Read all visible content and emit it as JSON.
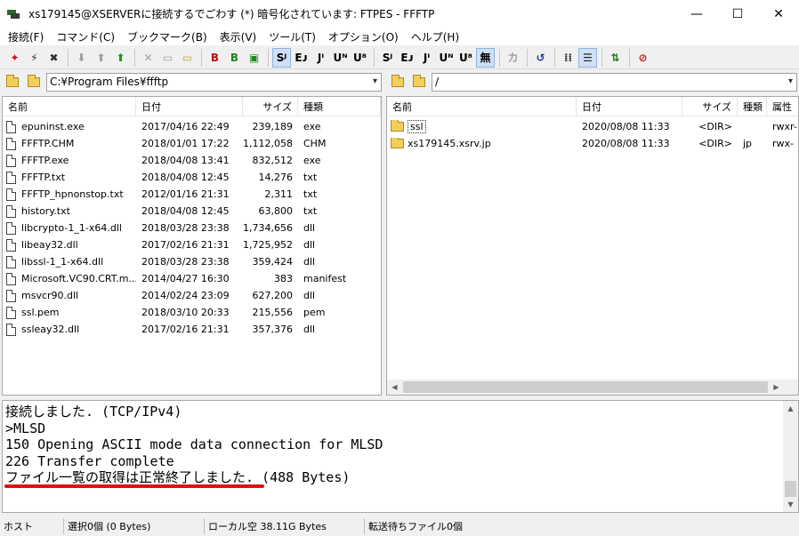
{
  "window": {
    "title": "xs179145@XSERVERに接続するでごわす (*) 暗号化されています: FTPES - FFFTP",
    "minimize": "—",
    "maximize": "☐",
    "close": "✕"
  },
  "menu": [
    "接続(F)",
    "コマンド(C)",
    "ブックマーク(B)",
    "表示(V)",
    "ツール(T)",
    "オプション(O)",
    "ヘルプ(H)"
  ],
  "toolbar": {
    "buttons": [
      {
        "name": "connect-icon",
        "glyph": "✦",
        "color": "#d01010"
      },
      {
        "name": "quick-connect-icon",
        "glyph": "⚡",
        "color": "#303030"
      },
      {
        "name": "disconnect-icon",
        "glyph": "✖",
        "color": "#303030"
      },
      {
        "name": "download-icon",
        "glyph": "⬇",
        "color": "#a0a0a0"
      },
      {
        "name": "upload-icon",
        "glyph": "⬆",
        "color": "#a0a0a0"
      },
      {
        "name": "mirror-upload-icon",
        "glyph": "⬆",
        "color": "#1a9a1a"
      },
      {
        "name": "delete-icon",
        "glyph": "✕",
        "color": "#a0a0a0"
      },
      {
        "name": "rename-icon",
        "glyph": "▭",
        "color": "#a0a0a0"
      },
      {
        "name": "mkdir-icon",
        "glyph": "▭",
        "color": "#c8a030"
      },
      {
        "name": "text-mode-icon",
        "glyph": "B",
        "color": "#c01010"
      },
      {
        "name": "binary-mode-icon",
        "glyph": "B",
        "color": "#1a8a1a"
      },
      {
        "name": "auto-mode-icon",
        "glyph": "▣",
        "color": "#1a8a1a"
      },
      {
        "name": "host-sjis-icon",
        "glyph": "Sᴶ",
        "color": "#000000"
      },
      {
        "name": "host-euc-icon",
        "glyph": "Eᴊ",
        "color": "#000000"
      },
      {
        "name": "host-jis-icon",
        "glyph": "Jᴵ",
        "color": "#000000"
      },
      {
        "name": "host-utf8n-icon",
        "glyph": "Uᴺ",
        "color": "#000000"
      },
      {
        "name": "host-utf8-icon",
        "glyph": "U⁸",
        "color": "#000000"
      },
      {
        "name": "local-sjis-icon",
        "glyph": "Sᴶ",
        "color": "#000000"
      },
      {
        "name": "local-euc-icon",
        "glyph": "Eᴊ",
        "color": "#000000"
      },
      {
        "name": "local-jis-icon",
        "glyph": "Jᴵ",
        "color": "#000000"
      },
      {
        "name": "local-utf8n-icon",
        "glyph": "Uᴺ",
        "color": "#000000"
      },
      {
        "name": "local-utf8-icon",
        "glyph": "U⁸",
        "color": "#000000"
      },
      {
        "name": "no-convert-icon",
        "glyph": "無",
        "color": "#000000"
      },
      {
        "name": "kana-icon",
        "glyph": "カ",
        "color": "#a0a0a0"
      },
      {
        "name": "refresh-icon",
        "glyph": "↺",
        "color": "#1a3aa0"
      },
      {
        "name": "list-view-icon",
        "glyph": "⁞⁞",
        "color": "#202020"
      },
      {
        "name": "detail-view-icon",
        "glyph": "☰",
        "color": "#202020"
      },
      {
        "name": "sync-icon",
        "glyph": "⇅",
        "color": "#1a7a1a"
      },
      {
        "name": "stop-icon",
        "glyph": "⊘",
        "color": "#d01010"
      }
    ]
  },
  "local": {
    "path": "C:¥Program Files¥ffftp",
    "headers": [
      "名前",
      "日付",
      "サイズ",
      "種類"
    ],
    "files": [
      {
        "name": "epuninst.exe",
        "date": "2017/04/16 22:49",
        "size": "239,189",
        "type": "exe"
      },
      {
        "name": "FFFTP.CHM",
        "date": "2018/01/01 17:22",
        "size": "1,112,058",
        "type": "CHM"
      },
      {
        "name": "FFFTP.exe",
        "date": "2018/04/08 13:41",
        "size": "832,512",
        "type": "exe"
      },
      {
        "name": "FFFTP.txt",
        "date": "2018/04/08 12:45",
        "size": "14,276",
        "type": "txt"
      },
      {
        "name": "FFFTP_hpnonstop.txt",
        "date": "2012/01/16 21:31",
        "size": "2,311",
        "type": "txt"
      },
      {
        "name": "history.txt",
        "date": "2018/04/08 12:45",
        "size": "63,800",
        "type": "txt"
      },
      {
        "name": "libcrypto-1_1-x64.dll",
        "date": "2018/03/28 23:38",
        "size": "1,734,656",
        "type": "dll"
      },
      {
        "name": "libeay32.dll",
        "date": "2017/02/16 21:31",
        "size": "1,725,952",
        "type": "dll"
      },
      {
        "name": "libssl-1_1-x64.dll",
        "date": "2018/03/28 23:38",
        "size": "359,424",
        "type": "dll"
      },
      {
        "name": "Microsoft.VC90.CRT.m...",
        "date": "2014/04/27 16:30",
        "size": "383",
        "type": "manifest"
      },
      {
        "name": "msvcr90.dll",
        "date": "2014/02/24 23:09",
        "size": "627,200",
        "type": "dll"
      },
      {
        "name": "ssl.pem",
        "date": "2018/03/10 20:33",
        "size": "215,556",
        "type": "pem"
      },
      {
        "name": "ssleay32.dll",
        "date": "2017/02/16 21:31",
        "size": "357,376",
        "type": "dll"
      }
    ]
  },
  "remote": {
    "path": "/",
    "headers": [
      "名前",
      "日付",
      "サイズ",
      "種類",
      "属性"
    ],
    "files": [
      {
        "name": "ssl",
        "date": "2020/08/08 11:33",
        "size": "<DIR>",
        "type": "",
        "attr": "rwxr-"
      },
      {
        "name": "xs179145.xsrv.jp",
        "date": "2020/08/08 11:33",
        "size": "<DIR>",
        "type": "jp",
        "attr": "rwx-"
      }
    ]
  },
  "log": [
    "接続しました. (TCP/IPv4)",
    ">MLSD",
    "150 Opening ASCII mode data connection for MLSD",
    "226 Transfer complete",
    "ファイル一覧の取得は正常終了しました. (488 Bytes)"
  ],
  "status": {
    "host": "ホスト",
    "selection": "選択0個 (0 Bytes)",
    "local_free": "ローカル空 38.11G Bytes",
    "queue": "転送待ちファイル0個"
  },
  "colors": {
    "highlight_underline": "#e01010",
    "folder": "#f3cf5a"
  }
}
